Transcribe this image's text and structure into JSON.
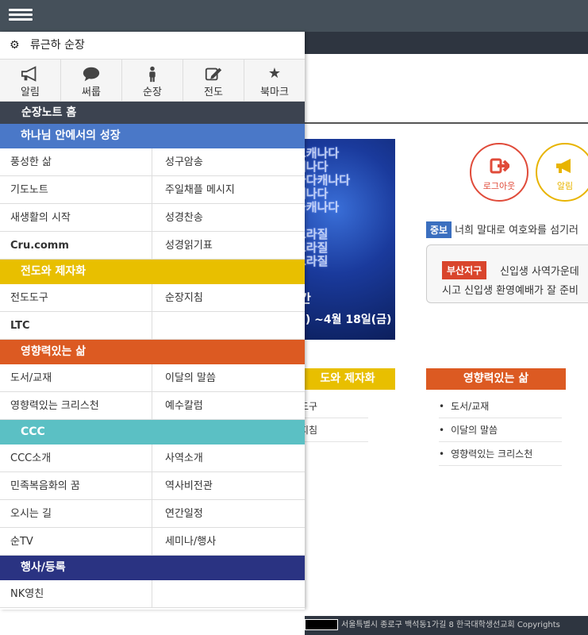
{
  "drawer": {
    "user_name": "류근하 순장",
    "quick_icons": [
      {
        "icon": "megaphone-icon",
        "label": "알림"
      },
      {
        "icon": "speech-bubble-icon",
        "label": "써룹"
      },
      {
        "icon": "person-icon",
        "label": "순장"
      },
      {
        "icon": "edit-icon",
        "label": "전도"
      },
      {
        "icon": "star-icon",
        "label": "북마크"
      }
    ],
    "home_label": "순장노트 홈",
    "categories": [
      {
        "title": "하나님 안에서의 성장",
        "color": "#4a78c8",
        "items": [
          "풍성한 삶",
          "성구암송",
          "기도노트",
          "주일채플 메시지",
          "새생활의 시작",
          "성경찬송",
          "Cru.comm",
          "성경읽기표"
        ]
      },
      {
        "title": "전도와 제자화",
        "color": "#e8bf00",
        "items": [
          "전도도구",
          "순장지침",
          "LTC",
          ""
        ]
      },
      {
        "title": "영향력있는 삶",
        "color": "#dc5a22",
        "items": [
          "도서/교재",
          "이달의 말씀",
          "영향력있는 크리스천",
          "예수칼럼"
        ]
      },
      {
        "title": "CCC",
        "color": "#5bc0c4",
        "items": [
          "CCC소개",
          "사역소개",
          "민족복음화의 꿈",
          "역사비전관",
          "오시는 길",
          "연간일정",
          "순TV",
          "세미나/행사"
        ]
      },
      {
        "title": "행사/등록",
        "color": "#2a3382",
        "items": [
          "NK영친",
          ""
        ]
      }
    ]
  },
  "background": {
    "banner_words": "그캐나다\n캐나다\n나다캐나다\n캐나다\n국캐나다\n\n브라질\n브라질\n브라질",
    "banner_fragment": "간",
    "banner_date": "월) ~4월 18일(금)",
    "logout_label": "로그아웃",
    "alarm_label": "알림",
    "notice1_tag": "중보",
    "notice1_text": "너희 말대로 여호와를 섬기러",
    "notice2_tag": "부산지구",
    "notice2_text1": "신입생 사역가운데",
    "notice2_text2": "시고 신입생 환영예배가 잘 준비",
    "section_yellow": "도와 제자화",
    "section_orange": "영향력있는 삶",
    "left_list": [
      "도구",
      "지침"
    ],
    "right_list": [
      "도서/교재",
      "이달의 말씀",
      "영향력있는 크리스천"
    ],
    "footer_text": "서울특별시 종로구 백석동1가길 8 한국대학생선교회 Copyrights"
  },
  "colors": {
    "topbar": "#45505a",
    "home_row": "#3c4350"
  }
}
